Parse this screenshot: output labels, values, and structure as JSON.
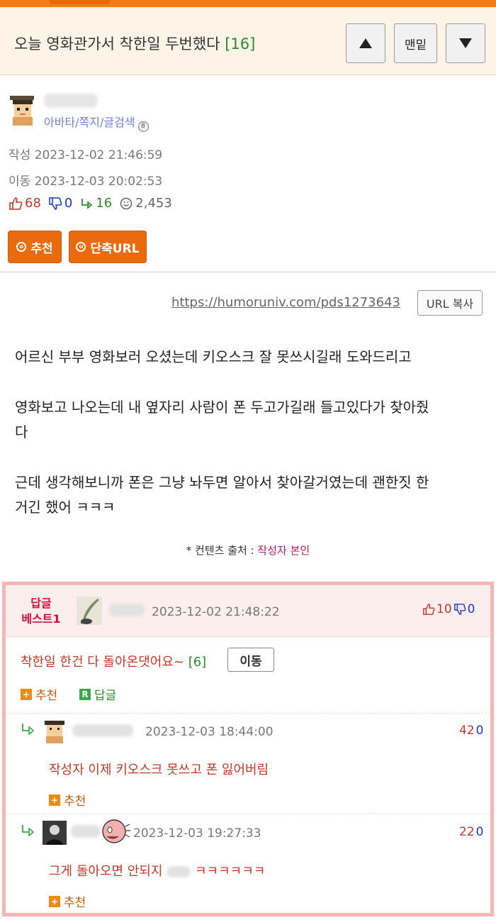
{
  "header": {
    "title": "오늘 영화관가서 착한일 두번했다",
    "comment_count": "[16]",
    "bottom_label": "맨밑"
  },
  "author": {
    "links": "아바타/쪽지/글검색",
    "written_label": "작성",
    "written": "2023-12-02 21:46:59",
    "moved_label": "이동",
    "moved": "2023-12-03 20:02:53"
  },
  "stats": {
    "up": "68",
    "down": "0",
    "replies": "16",
    "views": "2,453"
  },
  "actions": {
    "recommend": "추천",
    "short_url": "단축URL"
  },
  "post": {
    "url": "https://humoruniv.com/pds1273643",
    "copy_label": "URL 복사",
    "lines": [
      "어르신 부부 영화보러 오셨는데 키오스크 잘 못쓰시길래 도와드리고",
      "영화보고 나오는데 내 옆자리 사람이 폰 두고가길래 들고있다가 찾아줬",
      "다",
      "근데 생각해보니까 폰은 그냥 놔두면 알아서 찾아갈거였는데 괜한짓 한",
      "거긴 했어 ㅋㅋㅋ"
    ],
    "source_prefix": "* 컨텐츠 출처 :",
    "source_who": "작성자 본인"
  },
  "best_comment": {
    "label_line1": "답글",
    "label_line2": "베스트1",
    "date": "2023-12-02 21:48:22",
    "up": "10",
    "down": "0",
    "text": "착한일 한건 다 돌아온댓어요~",
    "reply_count": "[6]",
    "move_label": "이동",
    "recommend": "추천",
    "reply": "답글"
  },
  "replies": [
    {
      "date": "2023-12-03 18:44:00",
      "up": "42",
      "down": "0",
      "text": "작성자 이제 키오스크 못쓰고 폰 잃어버림",
      "recommend": "추천"
    },
    {
      "date": "2023-12-03 19:27:33",
      "up": "22",
      "down": "0",
      "text": "그게 돌아오면 안되지",
      "text_end": "ㅋㅋㅋㅋㅋㅋ",
      "recommend": "추천"
    }
  ],
  "colors": {
    "accent": "#ea6a0e",
    "up": "#c0392b",
    "down": "#1a3cc9",
    "reply": "#2f8a2f",
    "best_border": "#f5b6b6"
  }
}
